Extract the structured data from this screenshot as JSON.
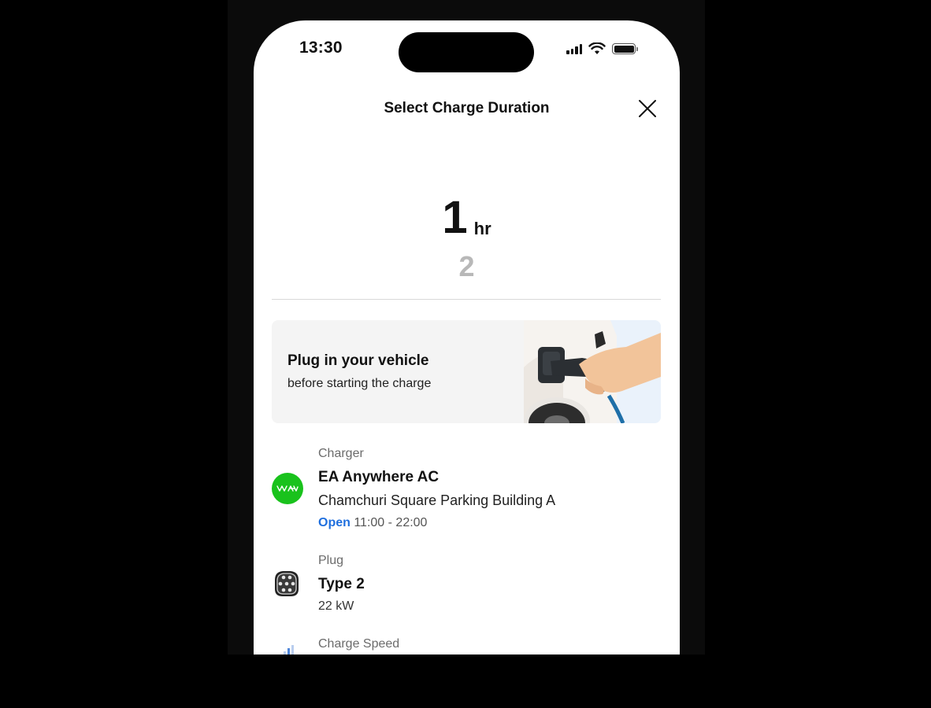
{
  "status_bar": {
    "time": "13:30"
  },
  "header": {
    "title": "Select Charge Duration"
  },
  "picker": {
    "selected_value": "1",
    "unit": "hr",
    "next_value": "2"
  },
  "banner": {
    "title": "Plug in your vehicle",
    "subtitle": "before starting the charge"
  },
  "charger": {
    "label": "Charger",
    "name": "EA Anywhere AC",
    "location": "Chamchuri Square Parking Building A",
    "status": "Open",
    "hours": "11:00 - 22:00",
    "logo_color": "#19c21c"
  },
  "plug": {
    "label": "Plug",
    "type": "Type 2",
    "power": "22 kW"
  },
  "charge_speed": {
    "label": "Charge Speed"
  },
  "colors": {
    "accent_blue": "#1f6fde",
    "brand_green": "#19c21c"
  }
}
